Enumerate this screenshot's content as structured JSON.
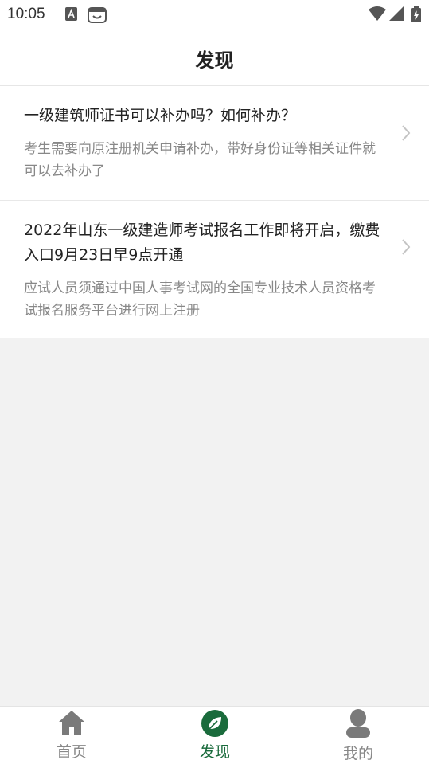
{
  "status_bar": {
    "time": "10:05"
  },
  "header": {
    "title": "发现"
  },
  "articles": [
    {
      "title": "一级建筑师证书可以补办吗？如何补办？",
      "summary": "考生需要向原注册机关申请补办，带好身份证等相关证件就可以去补办了"
    },
    {
      "title": "2022年山东一级建造师考试报名工作即将开启，缴费入口9月23日早9点开通",
      "summary": "应试人员须通过中国人事考试网的全国专业技术人员资格考试报名服务平台进行网上注册"
    }
  ],
  "tabbar": {
    "items": [
      {
        "label": "首页",
        "icon": "home-icon",
        "active": false
      },
      {
        "label": "发现",
        "icon": "leaf-icon",
        "active": true
      },
      {
        "label": "我的",
        "icon": "person-icon",
        "active": false
      }
    ]
  },
  "colors": {
    "accent": "#1a6b3c",
    "inactive_tab": "#888888",
    "background": "#f2f2f2"
  }
}
